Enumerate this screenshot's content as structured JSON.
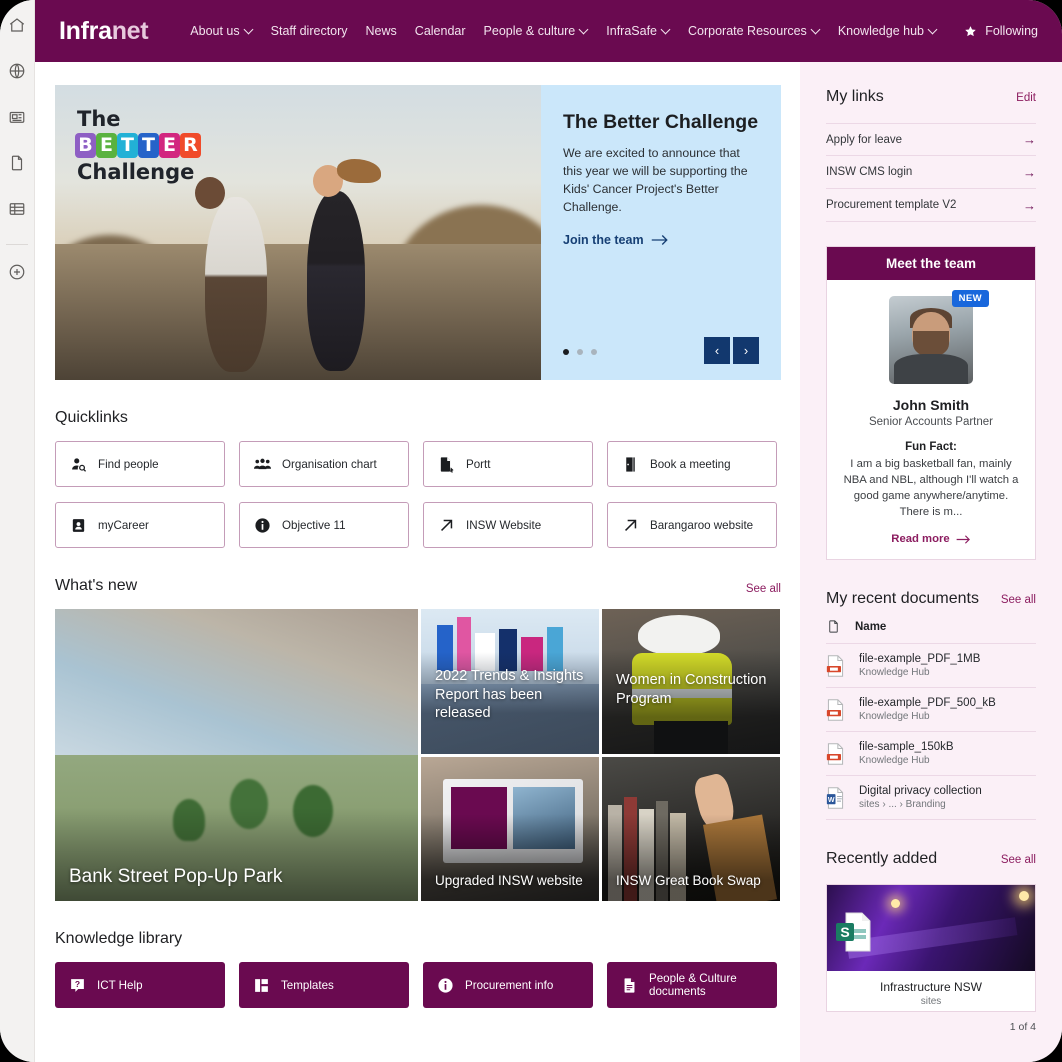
{
  "rail": {
    "items": [
      {
        "name": "home-icon",
        "label": "Home"
      },
      {
        "name": "globe-icon",
        "label": "Global navigation"
      },
      {
        "name": "news-icon",
        "label": "News"
      },
      {
        "name": "document-icon",
        "label": "Files"
      },
      {
        "name": "list-icon",
        "label": "Lists"
      },
      {
        "name": "plus-circle-icon",
        "label": "Create"
      }
    ]
  },
  "header": {
    "logo_first": "Infra",
    "logo_second": "net",
    "nav": [
      {
        "label": "About us",
        "caret": true
      },
      {
        "label": "Staff directory",
        "caret": false
      },
      {
        "label": "News",
        "caret": false
      },
      {
        "label": "Calendar",
        "caret": false
      },
      {
        "label": "People & culture",
        "caret": true
      },
      {
        "label": "InfraSafe",
        "caret": true
      },
      {
        "label": "Corporate Resources",
        "caret": true
      },
      {
        "label": "Knowledge hub",
        "caret": true
      }
    ],
    "following_label": "Following",
    "brand_color": "#6a0a50"
  },
  "hero": {
    "logo_line1": "The",
    "logo_word": "BETTER",
    "logo_letters": [
      {
        "ch": "B",
        "color": "#8e5fc4"
      },
      {
        "ch": "E",
        "color": "#5ab23f"
      },
      {
        "ch": "T",
        "color": "#22b1d6"
      },
      {
        "ch": "T",
        "color": "#2563c9"
      },
      {
        "ch": "E",
        "color": "#d2267f"
      },
      {
        "ch": "R",
        "color": "#f04b2a"
      }
    ],
    "logo_line3": "Challenge",
    "title": "The Better Challenge",
    "body": "We are excited to announce that this year we will be supporting the Kids' Cancer Project's Better Challenge.",
    "cta": "Join the team",
    "dots": 3,
    "active_dot": 1,
    "prev": "‹",
    "next": "›",
    "panel_color": "#cbe7fa",
    "button_color": "#12386e"
  },
  "quicklinks": {
    "title": "Quicklinks",
    "items": [
      {
        "label": "Find people",
        "icon": "person-search-icon"
      },
      {
        "label": "Organisation chart",
        "icon": "people-group-icon"
      },
      {
        "label": "Portt",
        "icon": "file-pin-icon"
      },
      {
        "label": "Book a meeting",
        "icon": "door-icon"
      },
      {
        "label": "myCareer",
        "icon": "id-card-icon"
      },
      {
        "label": "Objective 11",
        "icon": "info-circle-icon"
      },
      {
        "label": "INSW Website",
        "icon": "external-link-icon"
      },
      {
        "label": "Barangaroo website",
        "icon": "external-link-icon"
      }
    ]
  },
  "whats_new": {
    "title": "What's new",
    "see_all": "See all",
    "tiles": [
      {
        "caption": "Bank Street Pop-Up Park",
        "size": "large"
      },
      {
        "caption": "2022 Trends & Insights Report has been released",
        "size": "small"
      },
      {
        "caption": "Women in Construction Program",
        "size": "small"
      },
      {
        "caption": "Upgraded INSW website",
        "size": "small"
      },
      {
        "caption": "INSW Great Book Swap",
        "size": "small"
      }
    ]
  },
  "knowledge_library": {
    "title": "Knowledge library",
    "items": [
      {
        "label": "ICT Help",
        "icon": "question-help-icon"
      },
      {
        "label": "Templates",
        "icon": "layout-template-icon"
      },
      {
        "label": "Procurement info",
        "icon": "info-circle-icon"
      },
      {
        "label": "People & Culture documents",
        "icon": "document-icon"
      }
    ]
  },
  "my_links": {
    "title": "My links",
    "edit": "Edit",
    "items": [
      {
        "label": "Apply for leave"
      },
      {
        "label": "INSW CMS login"
      },
      {
        "label": "Procurement template V2"
      }
    ]
  },
  "meet_the_team": {
    "header": "Meet the team",
    "badge": "NEW",
    "name": "John Smith",
    "role": "Senior Accounts Partner",
    "fun_fact_label": "Fun Fact:",
    "fun_fact": "I am a big basketball fan, mainly NBA and NBL, although I'll watch a good game anywhere/anytime. There is m...",
    "read_more": "Read more"
  },
  "recent_documents": {
    "title": "My recent documents",
    "see_all": "See all",
    "column_header": "Name",
    "rows": [
      {
        "name": "file-example_PDF_1MB",
        "sub": "Knowledge Hub",
        "icon": "pdf-file-icon"
      },
      {
        "name": "file-example_PDF_500_kB",
        "sub": "Knowledge Hub",
        "icon": "pdf-file-icon"
      },
      {
        "name": "file-sample_150kB",
        "sub": "Knowledge Hub",
        "icon": "pdf-file-icon"
      },
      {
        "name": "Digital privacy collection",
        "sub": "sites › ... › Branding",
        "icon": "word-file-icon"
      }
    ]
  },
  "recently_added": {
    "title": "Recently added",
    "see_all": "See all",
    "card_title": "Infrastructure NSW",
    "card_sub": "sites",
    "pager": "1 of 4",
    "icon": "sharepoint-site-icon"
  }
}
